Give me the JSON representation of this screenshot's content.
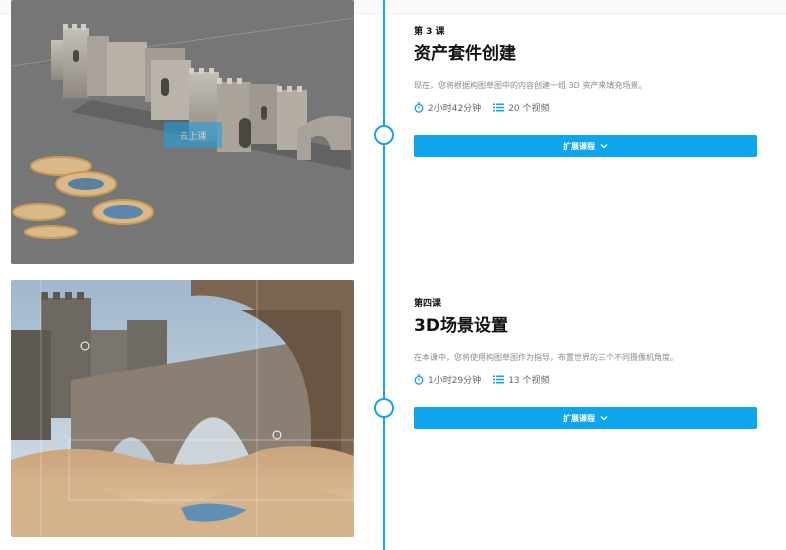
{
  "colors": {
    "accent": "#1aa3e8",
    "button_bg": "#0ea5ec",
    "muted_text": "#8a8a8a"
  },
  "lessons": [
    {
      "label": "第 3 课",
      "title": "资产套件创建",
      "description": "现在，您将根据构图草图中的内容创建一组 3D 资产来填充场景。",
      "duration": "2小时42分钟",
      "videos": "20 个视频",
      "expand_label": "扩展课程",
      "thumbnail_overlay_label": "去上课",
      "icons": {
        "duration": "stopwatch-icon",
        "videos": "list-icon",
        "expand": "chevron-down-icon"
      }
    },
    {
      "label": "第四课",
      "title": "3D场景设置",
      "description": "在本课中，您将使用构图草图作为指导，布置世界的三个不同摄像机角度。",
      "duration": "1小时29分钟",
      "videos": "13 个视频",
      "expand_label": "扩展课程",
      "icons": {
        "duration": "stopwatch-icon",
        "videos": "list-icon",
        "expand": "chevron-down-icon"
      }
    }
  ]
}
